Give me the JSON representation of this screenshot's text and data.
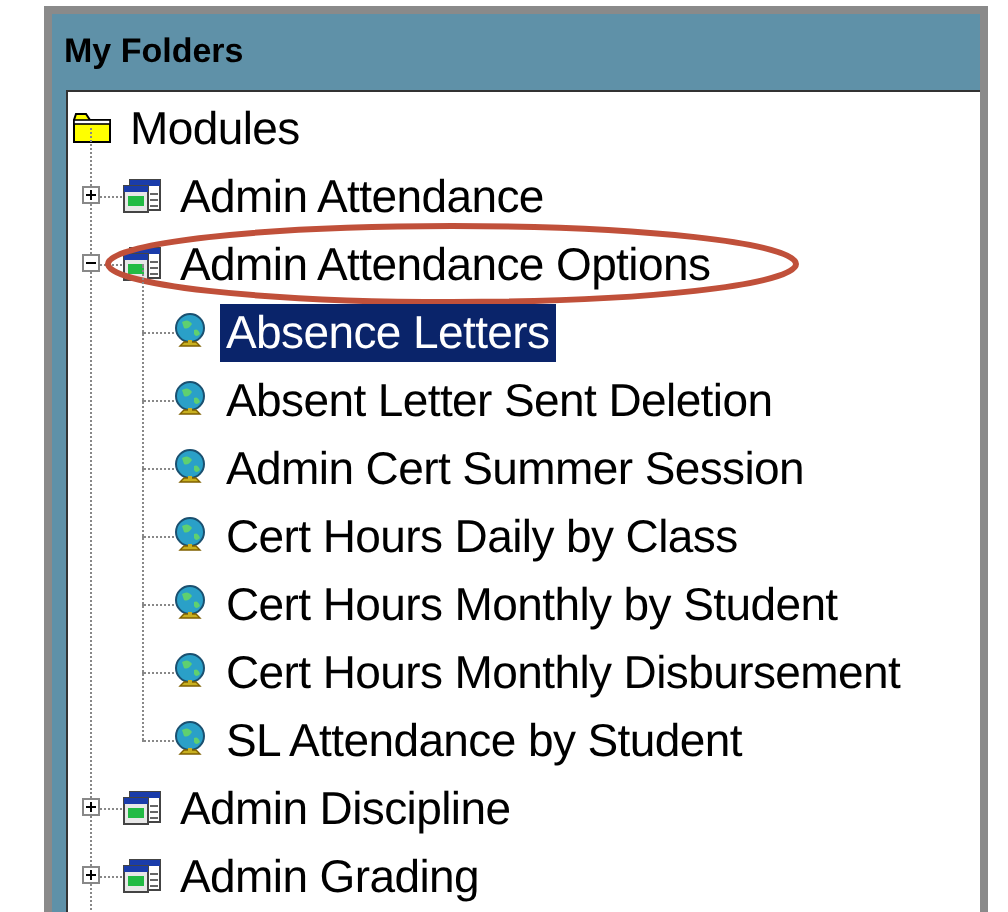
{
  "panel": {
    "title": "My Folders"
  },
  "tree": [
    {
      "label": "Modules",
      "kind": "folder",
      "expanded": true,
      "selected": false,
      "children": [
        {
          "label": "Admin Attendance",
          "kind": "module",
          "expanded": false,
          "selected": false
        },
        {
          "label": "Admin Attendance Options",
          "kind": "module",
          "expanded": true,
          "selected": false,
          "circled": true,
          "children": [
            {
              "label": "Absence Letters",
              "kind": "report",
              "selected": true
            },
            {
              "label": "Absent Letter Sent Deletion",
              "kind": "report",
              "selected": false
            },
            {
              "label": "Admin Cert Summer Session",
              "kind": "report",
              "selected": false
            },
            {
              "label": "Cert Hours Daily by Class",
              "kind": "report",
              "selected": false
            },
            {
              "label": "Cert Hours Monthly by Student",
              "kind": "report",
              "selected": false
            },
            {
              "label": "Cert Hours Monthly Disbursement",
              "kind": "report",
              "selected": false
            },
            {
              "label": "SL Attendance by Student",
              "kind": "report",
              "selected": false
            }
          ]
        },
        {
          "label": "Admin Discipline",
          "kind": "module",
          "expanded": false,
          "selected": false
        },
        {
          "label": "Admin Grading",
          "kind": "module",
          "expanded": false,
          "selected": false
        }
      ]
    }
  ]
}
